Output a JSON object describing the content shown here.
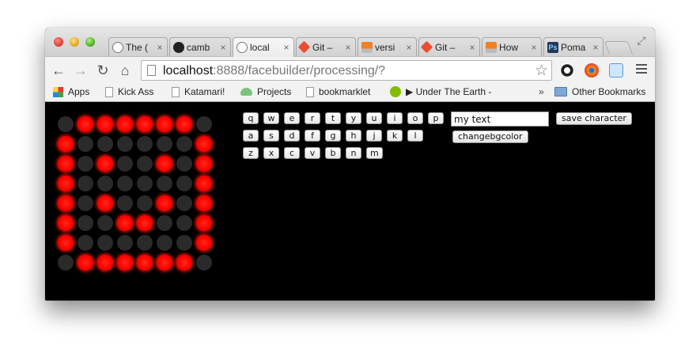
{
  "browser": {
    "tabs": [
      {
        "title": "The (",
        "icon": "globe-icon",
        "active": false
      },
      {
        "title": "camb",
        "icon": "github-icon",
        "active": false
      },
      {
        "title": "local",
        "icon": "globe-icon",
        "active": true
      },
      {
        "title": "Git –",
        "icon": "git-icon",
        "active": false
      },
      {
        "title": "versi",
        "icon": "stackoverflow-icon",
        "active": false
      },
      {
        "title": "Git –",
        "icon": "git-icon",
        "active": false
      },
      {
        "title": "How",
        "icon": "stackoverflow-icon",
        "active": false
      },
      {
        "title": "Poma",
        "icon": "ps-icon",
        "active": false
      }
    ],
    "url": {
      "host": "localhost",
      "rest": ":8888/facebuilder/processing/?"
    },
    "bookmarks": [
      {
        "label": "Apps",
        "icon": "apps-grid-icon"
      },
      {
        "label": "Kick Ass",
        "icon": "page-icon"
      },
      {
        "label": "Katamari!",
        "icon": "page-icon"
      },
      {
        "label": "Projects",
        "icon": "cloud-icon"
      },
      {
        "label": "bookmarklet",
        "icon": "page-icon"
      },
      {
        "label": "▶ Under The Earth -",
        "icon": "spotify-icon"
      }
    ],
    "bookmarks_overflow": "»",
    "other_bookmarks": "Other Bookmarks"
  },
  "app": {
    "led_matrix": [
      [
        0,
        1,
        1,
        1,
        1,
        1,
        1,
        0
      ],
      [
        1,
        0,
        0,
        0,
        0,
        0,
        0,
        1
      ],
      [
        1,
        0,
        1,
        0,
        0,
        1,
        0,
        1
      ],
      [
        1,
        0,
        0,
        0,
        0,
        0,
        0,
        1
      ],
      [
        1,
        0,
        1,
        0,
        0,
        1,
        0,
        1
      ],
      [
        1,
        0,
        0,
        1,
        1,
        0,
        0,
        1
      ],
      [
        1,
        0,
        0,
        0,
        0,
        0,
        0,
        1
      ],
      [
        0,
        1,
        1,
        1,
        1,
        1,
        1,
        0
      ]
    ],
    "on_color": "#ff0000",
    "off_color": "#2a2a2a",
    "keyboard_rows": [
      [
        "q",
        "w",
        "e",
        "r",
        "t",
        "y",
        "u",
        "i",
        "o",
        "p"
      ],
      [
        "a",
        "s",
        "d",
        "f",
        "g",
        "h",
        "j",
        "k",
        "l"
      ],
      [
        "z",
        "x",
        "c",
        "v",
        "b",
        "n",
        "m"
      ]
    ],
    "text_value": "my text",
    "save_label": "save character",
    "changebg_label": "changebgcolor"
  }
}
